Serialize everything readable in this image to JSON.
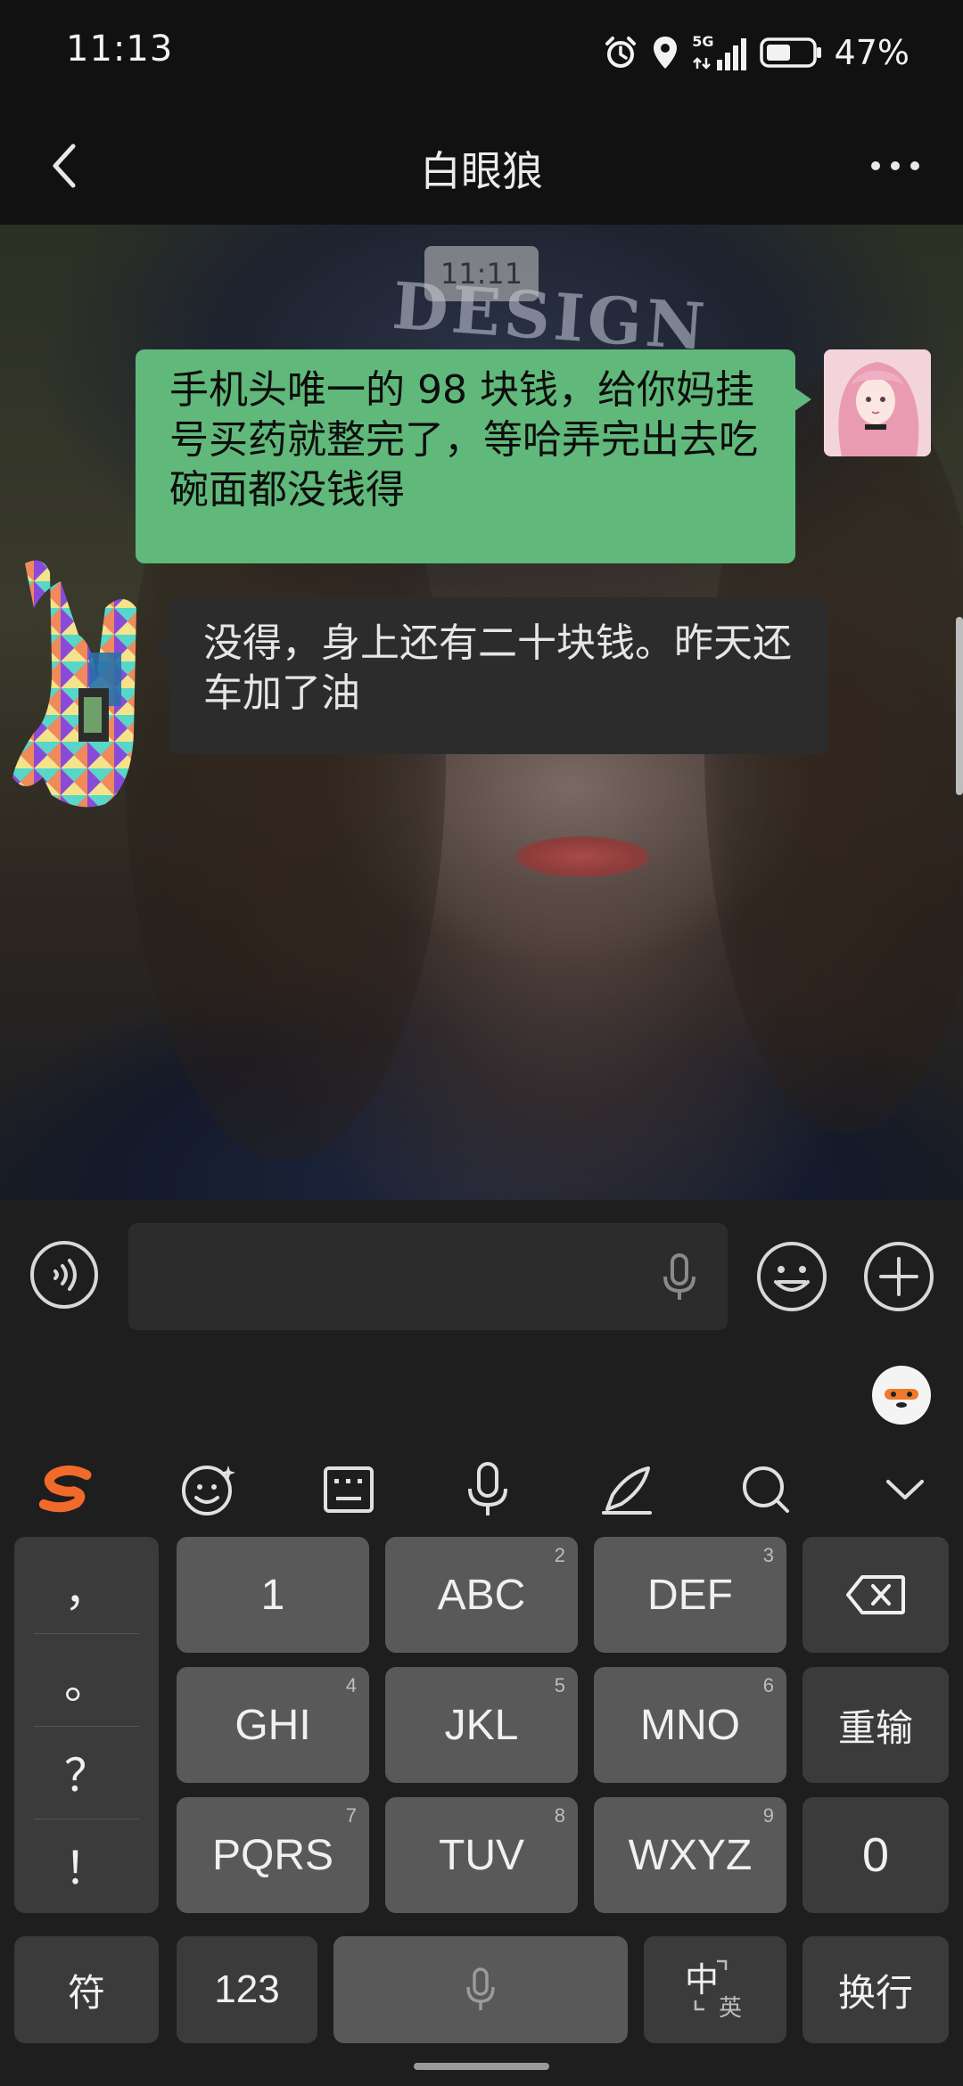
{
  "status_bar": {
    "time": "11:13",
    "network": "5G",
    "battery": "47%"
  },
  "header": {
    "title": "白眼狼"
  },
  "chat": {
    "timestamp": "11:11",
    "messages": [
      {
        "side": "outgoing",
        "text": "手机头唯一的 98 块钱，给你妈挂号买药就整完了，等哈弄完出去吃碗面都没钱得"
      },
      {
        "side": "incoming",
        "text": "没得，身上还有二十块钱。昨天还车加了油"
      }
    ],
    "wallpaper_text": "DESIGN"
  },
  "input": {
    "value": "",
    "placeholder": ""
  },
  "keyboard": {
    "punctuation": [
      "，",
      "。",
      "？",
      "！"
    ],
    "row1": {
      "k1": "1",
      "k2": "ABC",
      "k2_sub": "2",
      "k3": "DEF",
      "k3_sub": "3"
    },
    "row2": {
      "k1": "GHI",
      "k1_sub": "4",
      "k2": "JKL",
      "k2_sub": "5",
      "k3": "MNO",
      "k3_sub": "6",
      "k4": "重输"
    },
    "row3": {
      "k1": "PQRS",
      "k1_sub": "7",
      "k2": "TUV",
      "k2_sub": "8",
      "k3": "WXYZ",
      "k3_sub": "9",
      "k4": "0"
    },
    "row4": {
      "symbol": "符",
      "numbers": "123",
      "lang_main": "中",
      "lang_sub": "英",
      "enter": "换行"
    }
  },
  "colors": {
    "outgoing_bubble": "#60b97a",
    "incoming_bubble": "#2c2c2c",
    "key": "#595959",
    "key_dark": "#3b3b3b",
    "brand_s": "#f26a2a"
  }
}
